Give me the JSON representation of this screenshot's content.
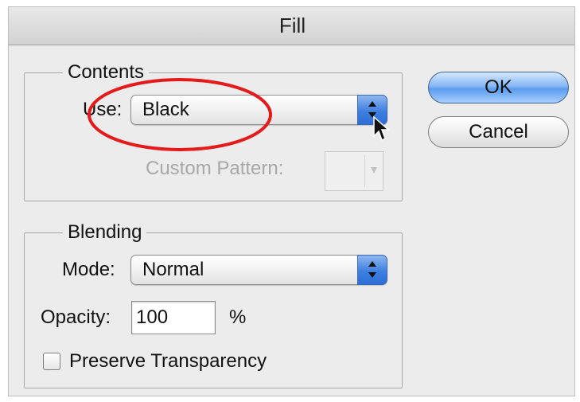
{
  "window": {
    "title": "Fill"
  },
  "contents": {
    "legend": "Contents",
    "use_label": "Use:",
    "use_value": "Black",
    "custom_pattern_label": "Custom Pattern:"
  },
  "blending": {
    "legend": "Blending",
    "mode_label": "Mode:",
    "mode_value": "Normal",
    "opacity_label": "Opacity:",
    "opacity_value": "100",
    "opacity_unit": "%",
    "preserve_label": "Preserve Transparency",
    "preserve_checked": false
  },
  "buttons": {
    "ok": "OK",
    "cancel": "Cancel"
  },
  "colors": {
    "ok_button": "#6aa6ee",
    "stepper": "#3f7fe0",
    "annotation": "#e31b1b"
  },
  "icons": [
    "up-down-stepper-icon",
    "dropdown-arrow-icon",
    "mouse-pointer-icon",
    "checkbox-icon"
  ]
}
